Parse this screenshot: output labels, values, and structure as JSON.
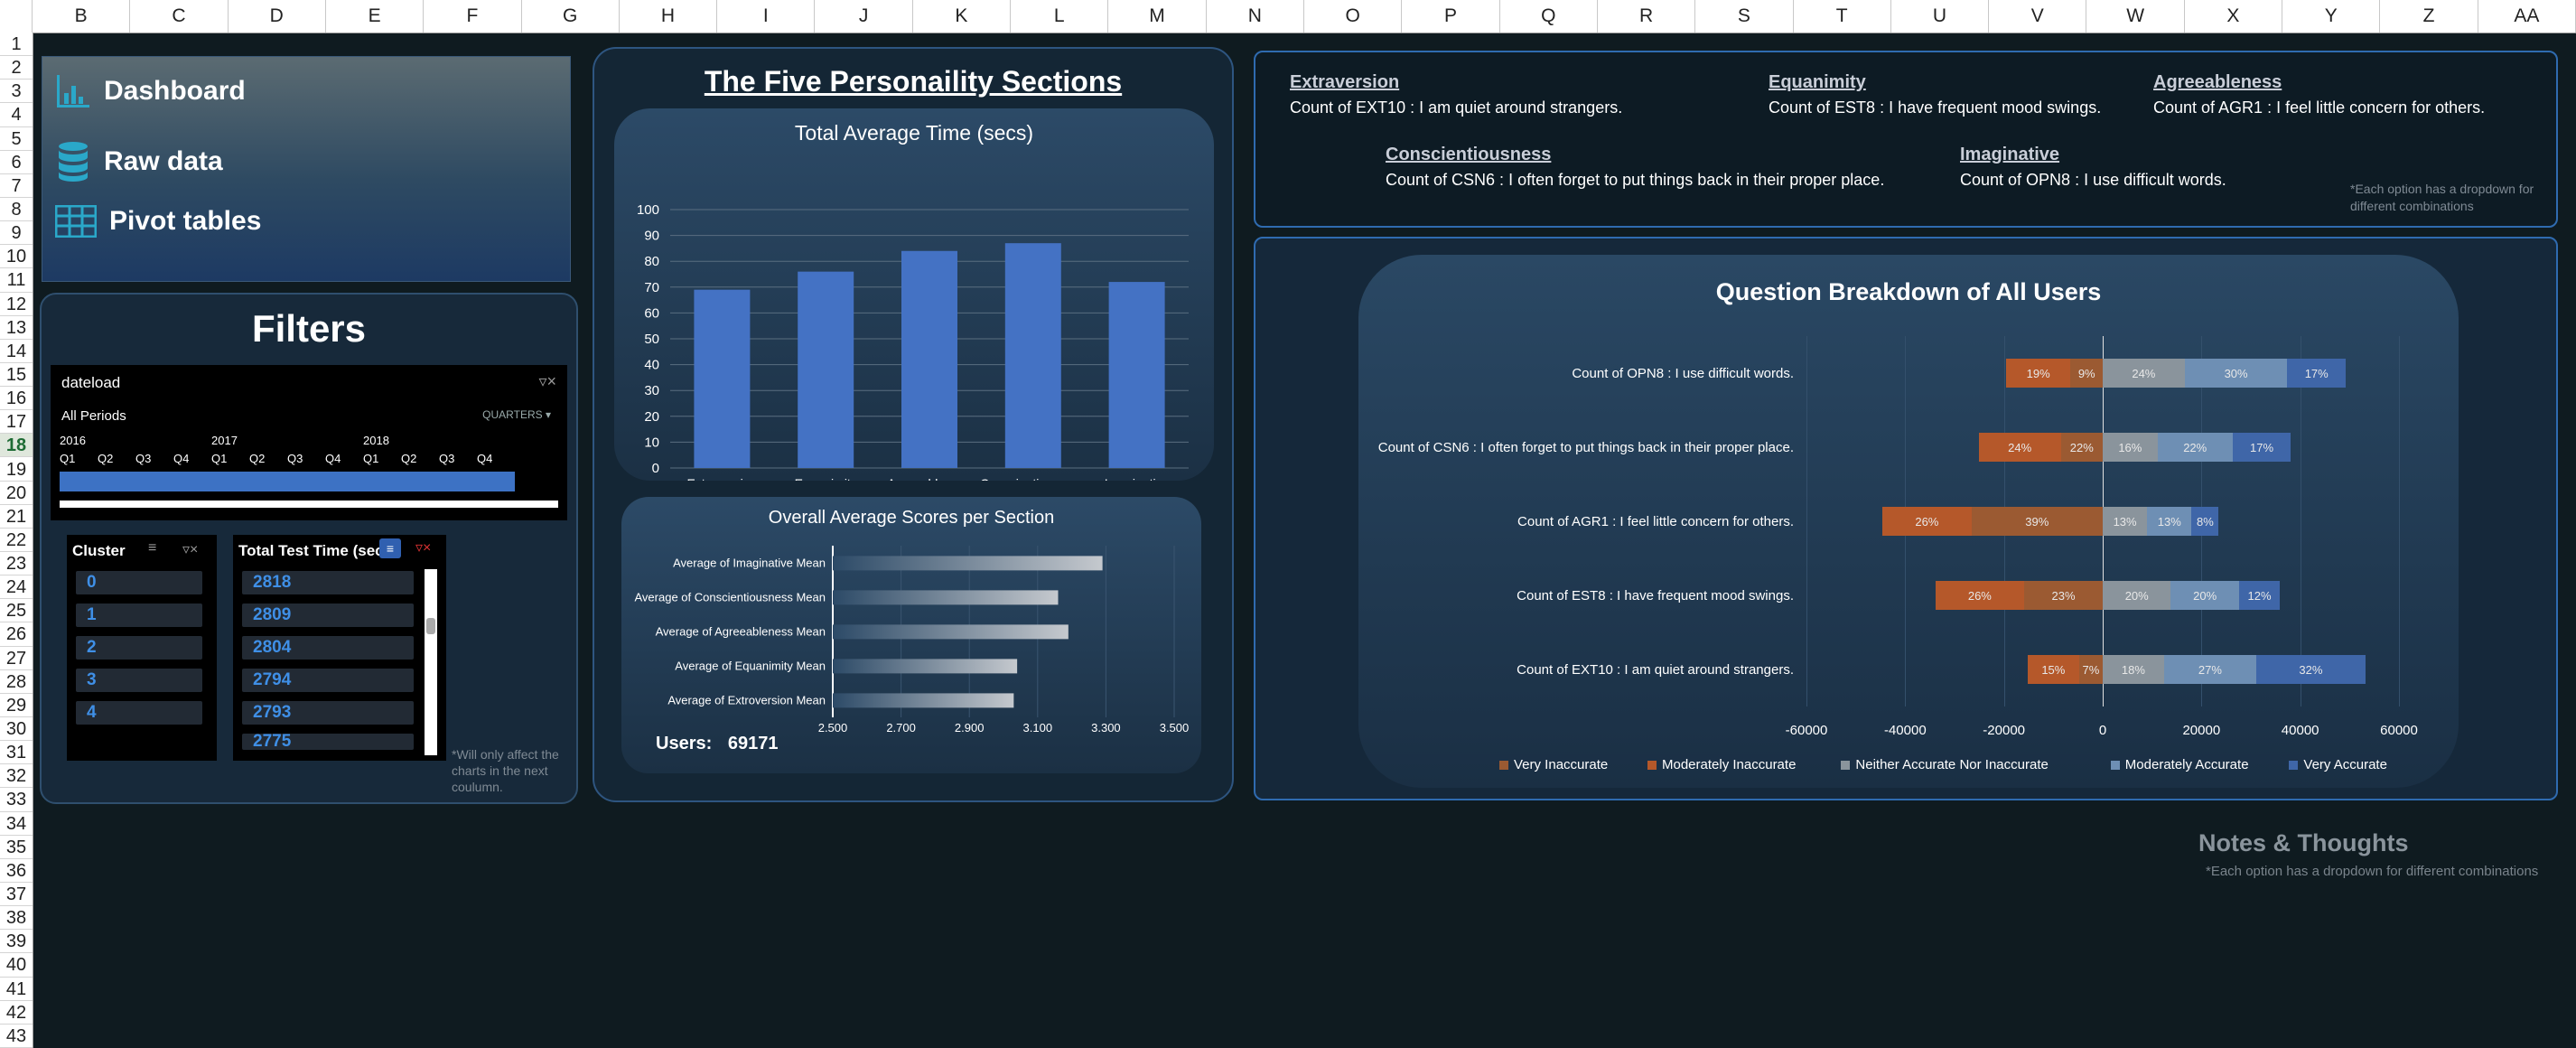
{
  "sheet": {
    "columns": [
      "B",
      "C",
      "D",
      "E",
      "F",
      "G",
      "H",
      "I",
      "J",
      "K",
      "L",
      "M",
      "N",
      "O",
      "P",
      "Q",
      "R",
      "S",
      "T",
      "U",
      "V",
      "W",
      "X",
      "Y",
      "Z",
      "AA"
    ],
    "rows": [
      "1",
      "2",
      "3",
      "4",
      "5",
      "6",
      "7",
      "8",
      "9",
      "10",
      "11",
      "12",
      "13",
      "14",
      "15",
      "16",
      "17",
      "18",
      "19",
      "20",
      "21",
      "22",
      "23",
      "24",
      "25",
      "26",
      "27",
      "28",
      "29",
      "30",
      "31",
      "32",
      "33",
      "34",
      "35",
      "36",
      "37",
      "38",
      "39",
      "40",
      "41",
      "42",
      "43"
    ],
    "selected_row": "18"
  },
  "nav": {
    "items": [
      {
        "label": "Dashboard",
        "icon": "bar-chart-icon"
      },
      {
        "label": "Raw data",
        "icon": "database-icon"
      },
      {
        "label": "Pivot tables",
        "icon": "table-icon"
      }
    ]
  },
  "filters": {
    "title": "Filters",
    "timeline": {
      "field": "dateload",
      "period": "All Periods",
      "level": "QUARTERS",
      "years": [
        "2016",
        "2017",
        "2018"
      ],
      "quarters": [
        "Q1",
        "Q2",
        "Q3",
        "Q4",
        "Q1",
        "Q2",
        "Q3",
        "Q4",
        "Q1",
        "Q2",
        "Q3",
        "Q4"
      ]
    },
    "cluster": {
      "title": "Cluster",
      "items": [
        "0",
        "1",
        "2",
        "3",
        "4"
      ]
    },
    "test_time": {
      "title": "Total Test Time (sec",
      "items": [
        "2818",
        "2809",
        "2804",
        "2794",
        "2793",
        "2775"
      ]
    },
    "note": "*Will only affect the charts in the next coulumn."
  },
  "middle": {
    "title": "The Five Personaility Sections",
    "users_label": "Users:",
    "users_value": "69171"
  },
  "chart_data": [
    {
      "type": "bar",
      "title": "Total Average Time (secs)",
      "categories": [
        "Extraversion Portion",
        "Equanimity Portion",
        "Agreeableness Portion",
        "Conscientiousness Portion",
        "Imaginative Portion"
      ],
      "values": [
        69,
        76,
        84,
        87,
        72
      ],
      "ylim": [
        0,
        100
      ],
      "yticks": [
        "0",
        "10",
        "20",
        "30",
        "40",
        "50",
        "60",
        "70",
        "80",
        "90",
        "100"
      ],
      "color": "#4472c4"
    },
    {
      "type": "bar",
      "orientation": "horizontal",
      "title": "Overall Average Scores per Section",
      "categories": [
        "Average of Imaginative Mean",
        "Average of Conscientiousness Mean",
        "Average of Agreeableness Mean",
        "Average of Equanimity Mean",
        "Average of Extroversion Mean"
      ],
      "values": [
        3.29,
        3.16,
        3.19,
        3.04,
        3.03
      ],
      "xlim": [
        2.5,
        3.5
      ],
      "xticks": [
        "2.500",
        "2.700",
        "2.900",
        "3.100",
        "3.300",
        "3.500"
      ]
    },
    {
      "type": "bar",
      "orientation": "horizontal",
      "stacked": "diverging",
      "title": "Question Breakdown of All Users",
      "categories": [
        "Count of OPN8 : I use difficult words.",
        "Count of CSN6 : I often forget to put things back in their proper place.",
        "Count of AGR1 : I feel little concern for others.",
        "Count of EST8 : I have frequent mood swings.",
        "Count of EXT10 : I am quiet around strangers."
      ],
      "series": [
        {
          "name": "Very Inaccurate",
          "color": "#9b5a32",
          "labels": [
            "9%",
            "22%",
            "39%",
            "23%",
            "7%"
          ],
          "values": [
            -6500,
            -8500,
            -26600,
            -15900,
            -4800
          ]
        },
        {
          "name": "Moderately Inaccurate",
          "color": "#b5582a",
          "labels": [
            "19%",
            "24%",
            "26%",
            "26%",
            "15%"
          ],
          "values": [
            -13100,
            -16600,
            -18000,
            -18000,
            -10400
          ]
        },
        {
          "name": "Neither Accurate Nor Inaccurate",
          "color": "#8a949c",
          "labels": [
            "24%",
            "16%",
            "13%",
            "20%",
            "18%"
          ],
          "values": [
            16600,
            11100,
            9000,
            13800,
            12400
          ]
        },
        {
          "name": "Moderately Accurate",
          "color": "#6e8fb4",
          "labels": [
            "30%",
            "22%",
            "13%",
            "20%",
            "27%"
          ],
          "values": [
            20800,
            15200,
            9000,
            13800,
            18700
          ]
        },
        {
          "name": "Very Accurate",
          "color": "#3f66a8",
          "labels": [
            "17%",
            "17%",
            "8%",
            "12%",
            "32%"
          ],
          "values": [
            11800,
            11800,
            5500,
            8300,
            22100
          ]
        }
      ],
      "xlim": [
        -60000,
        60000
      ],
      "xticks": [
        "-60000",
        "-40000",
        "-20000",
        "0",
        "20000",
        "40000",
        "60000"
      ]
    }
  ],
  "legend_box": {
    "items": [
      {
        "title": "Extraversion",
        "text": "Count of EXT10 : I am quiet around strangers."
      },
      {
        "title": "Equanimity",
        "text": "Count of EST8 : I have frequent mood swings."
      },
      {
        "title": "Agreeableness",
        "text": "Count of AGR1 : I feel little concern for others."
      },
      {
        "title": "Conscientiousness",
        "text": "Count of CSN6 : I often forget to put things back in their proper place."
      },
      {
        "title": "Imaginative",
        "text": "Count of OPN8 : I use difficult words."
      }
    ],
    "note": "*Each option has a dropdown for different combinations"
  },
  "notes": {
    "title": "Notes & Thoughts",
    "sub": "*Each option has a dropdown for different combinations"
  }
}
